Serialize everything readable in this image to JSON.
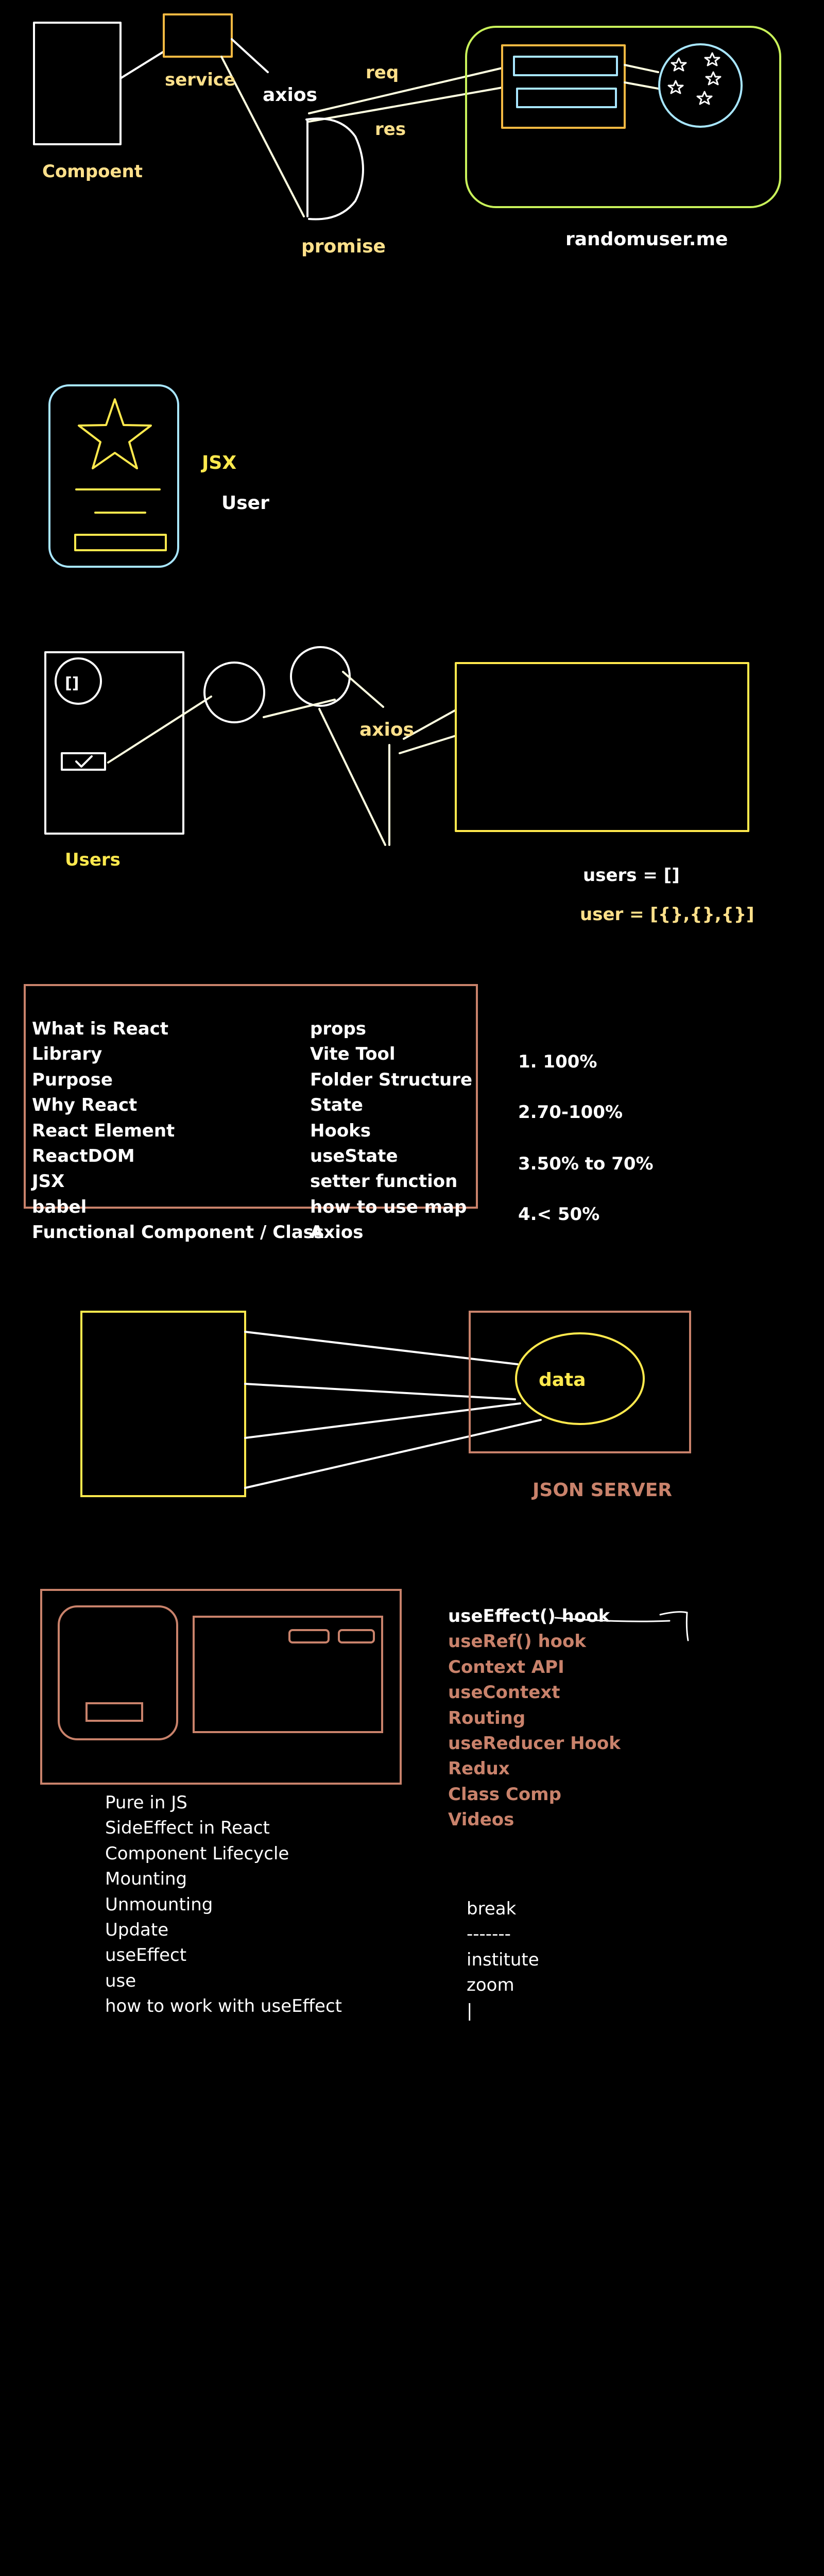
{
  "colors": {
    "background": "#000000",
    "white": "#ffffff",
    "yellow": "#ffe94d",
    "gold": "#ffe08a",
    "orange": "#f5b942",
    "lime": "#c9f25a",
    "cyan": "#a8e6ff",
    "salmon": "#c9826b",
    "peach": "#f1bf93"
  },
  "section1": {
    "component_label": "Compoent",
    "service_label": "service",
    "axios_label": "axios",
    "req_label": "req",
    "res_label": "res",
    "promise_label": "promise",
    "api_label": "randomuser.me"
  },
  "section2": {
    "jsx_label": "JSX",
    "user_label": "User"
  },
  "section3": {
    "brackets_label": "[]",
    "axios_label": "axios",
    "users_label": "Users",
    "users_empty": "users = []",
    "user_array": "user = [{},{},{}]"
  },
  "topics": {
    "left": [
      "What is React",
      "Library",
      "Purpose",
      "Why React",
      "React Element",
      "ReactDOM",
      "JSX",
      "babel",
      "Functional Component / Class"
    ],
    "right": [
      "props",
      "Vite Tool",
      "Folder Structure",
      "State",
      "Hooks",
      "useState",
      "setter function",
      "how to use map",
      "Axios"
    ],
    "scores": [
      "1. 100%",
      "2.70-100%",
      "3.50% to 70%",
      "4.< 50%"
    ]
  },
  "section5": {
    "data_label": "data",
    "server_label": "JSON SERVER"
  },
  "section6": {
    "list_left": [
      "Pure in JS",
      "SideEffect in React",
      "Component Lifecycle",
      "Mounting",
      "Unmounting",
      "Update",
      "useEffect",
      "use",
      "how to work with useEffect"
    ],
    "hook_current": "useEffect() hook",
    "hooks_upcoming": [
      "useRef() hook",
      "Context API",
      "useContext",
      "Routing",
      "useReducer Hook",
      "Redux",
      "Class Comp",
      "Videos"
    ],
    "notes": [
      "break",
      "-------",
      "institute",
      "zoom",
      "|"
    ]
  }
}
